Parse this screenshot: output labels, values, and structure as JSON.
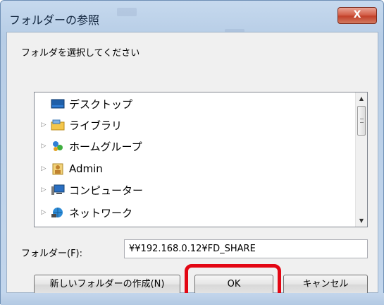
{
  "window": {
    "title": "フォルダーの参照",
    "close_label": "X"
  },
  "dialog": {
    "prompt": "フォルダを選択してください"
  },
  "tree": {
    "items": [
      {
        "label": "デスクトップ",
        "icon": "desktop-icon",
        "expandable": false
      },
      {
        "label": "ライブラリ",
        "icon": "library-icon",
        "expandable": true
      },
      {
        "label": "ホームグループ",
        "icon": "homegroup-icon",
        "expandable": true
      },
      {
        "label": "Admin",
        "icon": "user-folder-icon",
        "expandable": true,
        "selected": true
      },
      {
        "label": "コンピューター",
        "icon": "computer-icon",
        "expandable": true
      },
      {
        "label": "ネットワーク",
        "icon": "network-icon",
        "expandable": true
      }
    ]
  },
  "folder": {
    "label": "フォルダー(F):",
    "value": "¥¥192.168.0.12¥FD_SHARE"
  },
  "buttons": {
    "new_folder": "新しいフォルダーの作成(N)",
    "ok": "OK",
    "cancel": "キャンセル"
  },
  "colors": {
    "highlight": "#e30613",
    "titlebar": "#c6d9ee",
    "close_button": "#c2412a"
  }
}
